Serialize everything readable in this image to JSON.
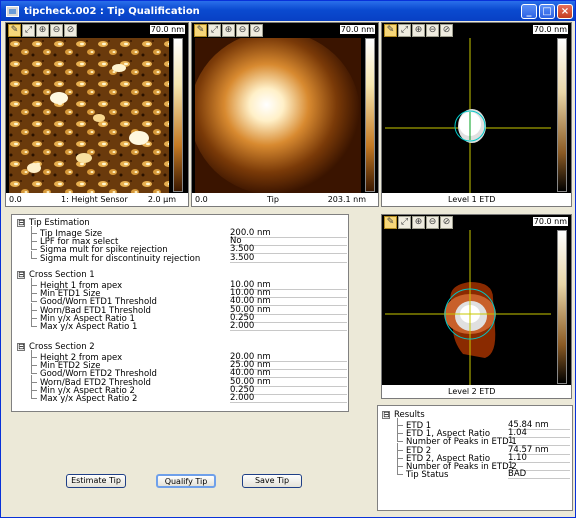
{
  "window": {
    "title": "tipcheck.002 : Tip Qualification",
    "min_label": "_",
    "max_label": "□",
    "close_label": "×"
  },
  "toolbar_glyphs": [
    "✎",
    "⤢",
    "⊕",
    "⊖",
    "⊘"
  ],
  "panels": {
    "height_sensor": {
      "scale": "70.0 nm",
      "left": "0.0",
      "center": "1: Height Sensor",
      "right": "2.0 µm"
    },
    "tip": {
      "scale": "70.0 nm",
      "left": "0.0",
      "center": "Tip",
      "right": "203.1 nm"
    },
    "level1": {
      "scale": "70.0 nm",
      "center": "Level 1 ETD"
    },
    "level2": {
      "scale": "70.0 nm",
      "center": "Level 2 ETD"
    }
  },
  "estimation": {
    "title": "Tip Estimation",
    "rows": [
      {
        "label": "Tip Image Size",
        "value": "200.0 nm"
      },
      {
        "label": "LPF for max select",
        "value": "No"
      },
      {
        "label": "Sigma mult for spike rejection",
        "value": "3.500"
      },
      {
        "label": "Sigma mult for discontinuity rejection",
        "value": "3.500"
      }
    ]
  },
  "cs1": {
    "title": "Cross Section 1",
    "rows": [
      {
        "label": "Height 1 from apex",
        "value": "10.00 nm"
      },
      {
        "label": "Min ETD1 Size",
        "value": "10.00 nm"
      },
      {
        "label": "Good/Worn ETD1 Threshold",
        "value": "40.00 nm"
      },
      {
        "label": "Worn/Bad ETD1 Threshold",
        "value": "50.00 nm"
      },
      {
        "label": "Min y/x Aspect Ratio 1",
        "value": "0.250"
      },
      {
        "label": "Max y/x Aspect Ratio 1",
        "value": "2.000"
      }
    ]
  },
  "cs2": {
    "title": "Cross Section 2",
    "rows": [
      {
        "label": "Height 2 from apex",
        "value": "20.00 nm"
      },
      {
        "label": "Min ETD2 Size",
        "value": "25.00 nm"
      },
      {
        "label": "Good/Worn ETD2 Threshold",
        "value": "40.00 nm"
      },
      {
        "label": "Worn/Bad ETD2 Threshold",
        "value": "50.00 nm"
      },
      {
        "label": "Min y/x Aspect Ratio 2",
        "value": "0.250"
      },
      {
        "label": "Max y/x Aspect Ratio 2",
        "value": "2.000"
      }
    ]
  },
  "results": {
    "title": "Results",
    "rows": [
      {
        "label": "ETD 1",
        "value": "45.84 nm"
      },
      {
        "label": "ETD 1, Aspect Ratio",
        "value": "1.04"
      },
      {
        "label": "Number of Peaks in ETD 1",
        "value": "1"
      },
      {
        "label": "ETD 2",
        "value": "74.57 nm"
      },
      {
        "label": "ETD 2, Aspect Ratio",
        "value": "1.10"
      },
      {
        "label": "Number of Peaks in ETD 2",
        "value": "1"
      },
      {
        "label": "Tip Status",
        "value": "BAD"
      }
    ]
  },
  "buttons": {
    "estimate": "Estimate Tip",
    "qualify": "Qualify Tip",
    "save": "Save Tip"
  },
  "expander": "⊟",
  "colors": {
    "title_bar": "#0a4ad0",
    "accent_yellow": "#f7d77a",
    "crosshair": "#c8c800",
    "circle": "#00c8c8"
  }
}
